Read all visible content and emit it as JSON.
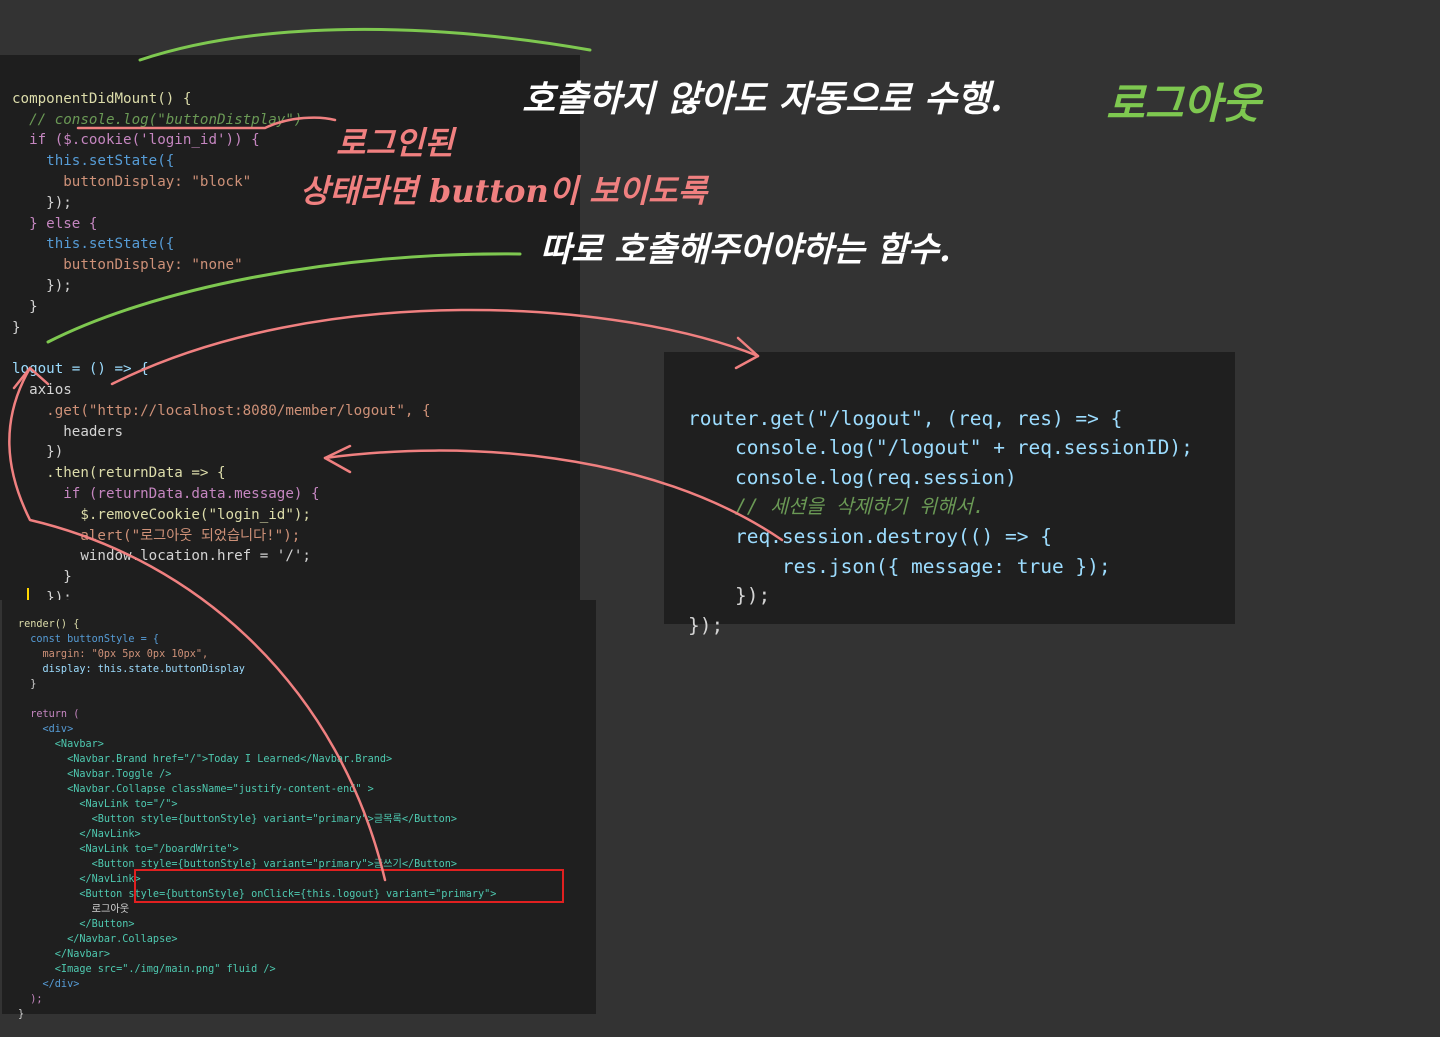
{
  "colors": {
    "background": "#333333",
    "panel": "#1e1e1e",
    "annotation_red": "#f08080",
    "annotation_green": "#7ec850",
    "highlight_box": "#e02020"
  },
  "annotations": {
    "auto_exec": "호출하지 않아도 자동으로 수행.",
    "logout_title": "로그아웃",
    "logged_in_line1": "로그인된",
    "logged_in_line2": "상태라면 button이 보이도록",
    "separate_call": "따로 호출해주어야하는 함수."
  },
  "code_panel_1": {
    "lines": [
      "componentDidMount() {",
      "  // console.log(\"buttonDistplay\")",
      "  if ($.cookie('login_id')) {",
      "    this.setState({",
      "      buttonDisplay: \"block\"",
      "    });",
      "  } else {",
      "    this.setState({",
      "      buttonDisplay: \"none\"",
      "    });",
      "  }",
      "}",
      "",
      "logout = () => {",
      "  axios",
      "    .get(\"http://localhost:8080/member/logout\", {",
      "      headers",
      "    })",
      "    .then(returnData => {",
      "      if (returnData.data.message) {",
      "        $.removeCookie(\"login_id\");",
      "        alert(\"로그아웃 되었습니다!\");",
      "        window.location.href = '/';",
      "      }",
      "    });",
      "};"
    ]
  },
  "code_panel_2": {
    "lines": [
      "render() {",
      "  const buttonStyle = {",
      "    margin: \"0px 5px 0px 10px\",",
      "    display: this.state.buttonDisplay",
      "  }",
      "",
      "  return (",
      "    <div>",
      "      <Navbar>",
      "        <Navbar.Brand href=\"/\">Today I Learned</Navbar.Brand>",
      "        <Navbar.Toggle />",
      "        <Navbar.Collapse className=\"justify-content-end\" >",
      "          <NavLink to=\"/\">",
      "            <Button style={buttonStyle} variant=\"primary\">글목록</Button>",
      "          </NavLink>",
      "          <NavLink to=\"/boardWrite\">",
      "            <Button style={buttonStyle} variant=\"primary\">글쓰기</Button>",
      "          </NavLink>",
      "          <Button style={buttonStyle} onClick={this.logout} variant=\"primary\">",
      "            로그아웃",
      "          </Button>",
      "        </Navbar.Collapse>",
      "      </Navbar>",
      "      <Image src=\"./img/main.png\" fluid />",
      "    </div>",
      "  );",
      "}"
    ]
  },
  "code_panel_3": {
    "lines": [
      "router.get(\"/logout\", (req, res) => {",
      "    console.log(\"/logout\" + req.sessionID);",
      "    console.log(req.session)",
      "    // 세션을 삭제하기 위해서.",
      "    req.session.destroy(() => {",
      "        res.json({ message: true });",
      "    });",
      "});"
    ]
  }
}
